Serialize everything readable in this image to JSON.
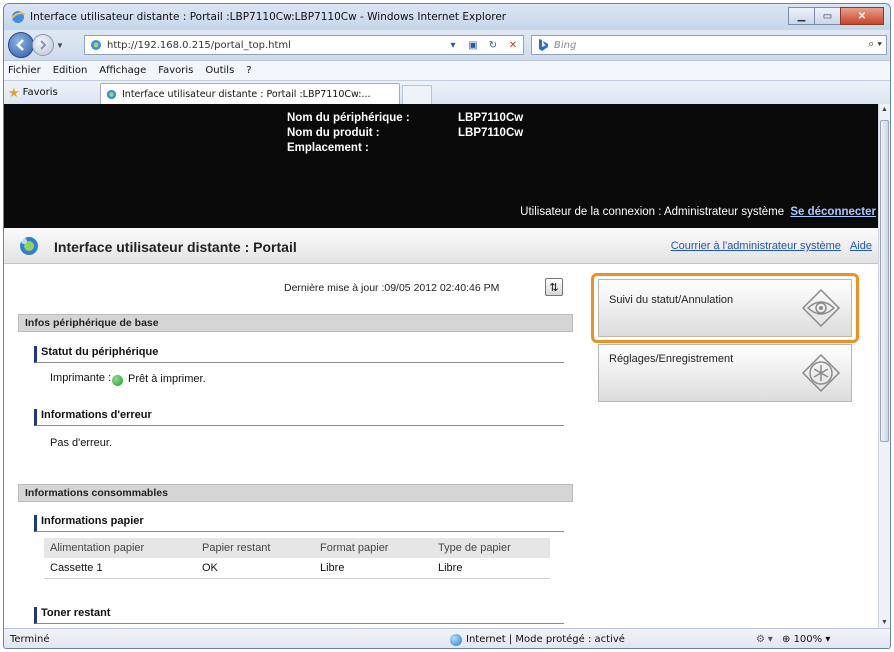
{
  "window": {
    "title": "Interface utilisateur distante : Portail :LBP7110Cw:LBP7110Cw - Windows Internet Explorer",
    "url": "http://192.168.0.215/portal_top.html",
    "search_placeholder": "Bing",
    "menu": [
      "Fichier",
      "Edition",
      "Affichage",
      "Favoris",
      "Outils",
      "?"
    ],
    "favorites_label": "Favoris",
    "tab_title": "Interface utilisateur distante : Portail :LBP7110Cw:..."
  },
  "device": {
    "name_label": "Nom du périphérique :",
    "name_value": "LBP7110Cw",
    "product_label": "Nom du produit :",
    "product_value": "LBP7110Cw",
    "location_label": "Emplacement :",
    "location_value": "",
    "login_text": "Utilisateur de la connexion : Administrateur système",
    "logout_label": "Se déconnecter"
  },
  "portal": {
    "title": "Interface utilisateur distante : Portail",
    "mail_admin_link": "Courrier à l'administrateur système",
    "help_link": "Aide",
    "last_update": "Dernière mise à jour :09/05 2012 02:40:46 PM"
  },
  "basic_info": {
    "section_title": "Infos périphérique de base",
    "status_heading": "Statut du périphérique",
    "printer_label": "Imprimante :",
    "printer_status": "Prêt à imprimer.",
    "error_heading": "Informations d'erreur",
    "error_text": "Pas d'erreur."
  },
  "consumables": {
    "section_title": "Informations consommables",
    "paper_heading": "Informations papier",
    "columns": [
      "Alimentation papier",
      "Papier restant",
      "Format papier",
      "Type de papier"
    ],
    "rows": [
      [
        "Cassette 1",
        "OK",
        "Libre",
        "Libre"
      ]
    ],
    "toner_heading": "Toner restant"
  },
  "sidebar": {
    "status_button": "Suivi du statut/Annulation",
    "settings_button": "Réglages/Enregistrement"
  },
  "statusbar": {
    "left": "Terminé",
    "zone": "Internet | Mode protégé : activé",
    "zoom": "100%"
  },
  "colors": {
    "highlight": "#f0901e",
    "header_bg": "#0a0a0a",
    "link": "#1f56b0"
  }
}
